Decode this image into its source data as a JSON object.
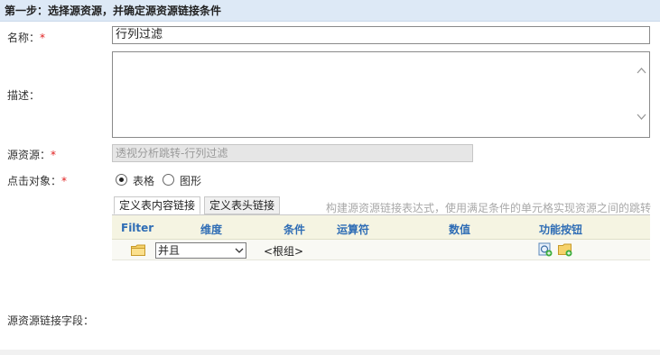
{
  "step_header": "第一步：选择源资源，并确定源资源链接条件",
  "form": {
    "name_label": "名称：",
    "name_value": "行列过滤",
    "desc_label": "描述：",
    "src_label": "源资源：",
    "src_value": "透视分析跳转-行列过滤",
    "click_label": "点击对象：",
    "radio_table": "表格",
    "radio_chart": "图形",
    "link_field_label": "源资源链接字段：",
    "required_mark": "*"
  },
  "tabs": [
    {
      "label": "定义表内容链接",
      "active": true
    },
    {
      "label": "定义表头链接",
      "active": false
    }
  ],
  "hint": "构建源资源链接表达式，使用满足条件的单元格实现资源之间的跳转",
  "grid": {
    "headers": [
      "Filter",
      "维度",
      "条件",
      "运算符",
      "数值",
      "功能按钮"
    ],
    "row": {
      "select_value": "并且",
      "root_label": "<根组>"
    }
  },
  "icons": [
    "folder-icon",
    "chevron-down-icon",
    "add-condition-icon",
    "add-group-icon",
    "scroll-up-icon",
    "scroll-down-icon"
  ],
  "colors": {
    "header_bg": "#dde9f6",
    "grid_header_text": "#2f6db5",
    "grid_header_bg": "#f5f4e2",
    "required": "#e02020",
    "hint_text": "#a8a8a8"
  }
}
